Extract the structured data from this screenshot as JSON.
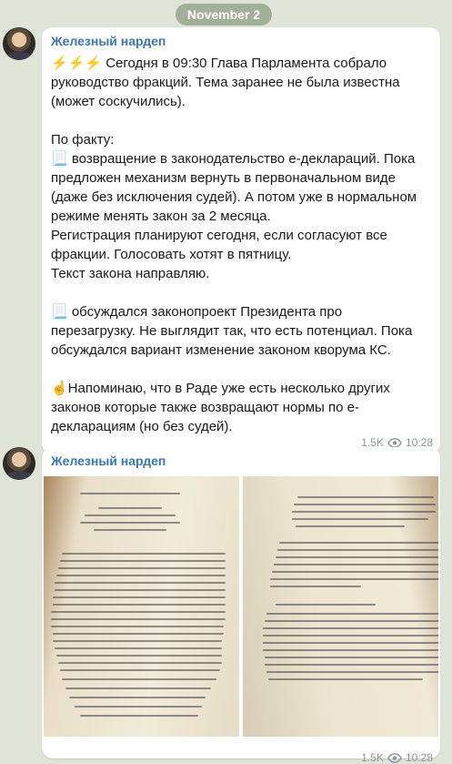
{
  "date_label": "November 2",
  "posts": [
    {
      "sender": "Железный нардеп",
      "text": "⚡⚡⚡ Сегодня в 09:30 Глава Парламента собрало руководство фракций. Тема заранее не была известна (может соскучились).\n\nПо факту:\n📃 возвращение в законодательство е-деклараций. Пока предложен механизм вернуть в первоначальном виде (даже без исключения судей). А потом уже в нормальном режиме менять закон за 2 месяца.\nРегистрация планируют сегодня, если согласуют все фракции. Голосовать хотят в пятницу.\nТекст закона направляю.\n\n📃 обсуждался законопроект Президента про перезагрузку. Не выглядит так, что есть потенциал. Пока обсуждался вариант изменение законом кворума КС.\n\n☝️Напоминаю, что в Раде уже есть несколько других законов которые также возвращают нормы по е-декларациям (но без судей).",
      "views": "1.5K",
      "time": "10:28"
    },
    {
      "sender": "Железный нардеп",
      "views": "1.5K",
      "time": "10:28"
    }
  ],
  "colors": {
    "sender": "#3a78b3",
    "background": "#dfe5d6",
    "meta": "#8c959d"
  },
  "icons": {
    "views": "eye-icon"
  }
}
